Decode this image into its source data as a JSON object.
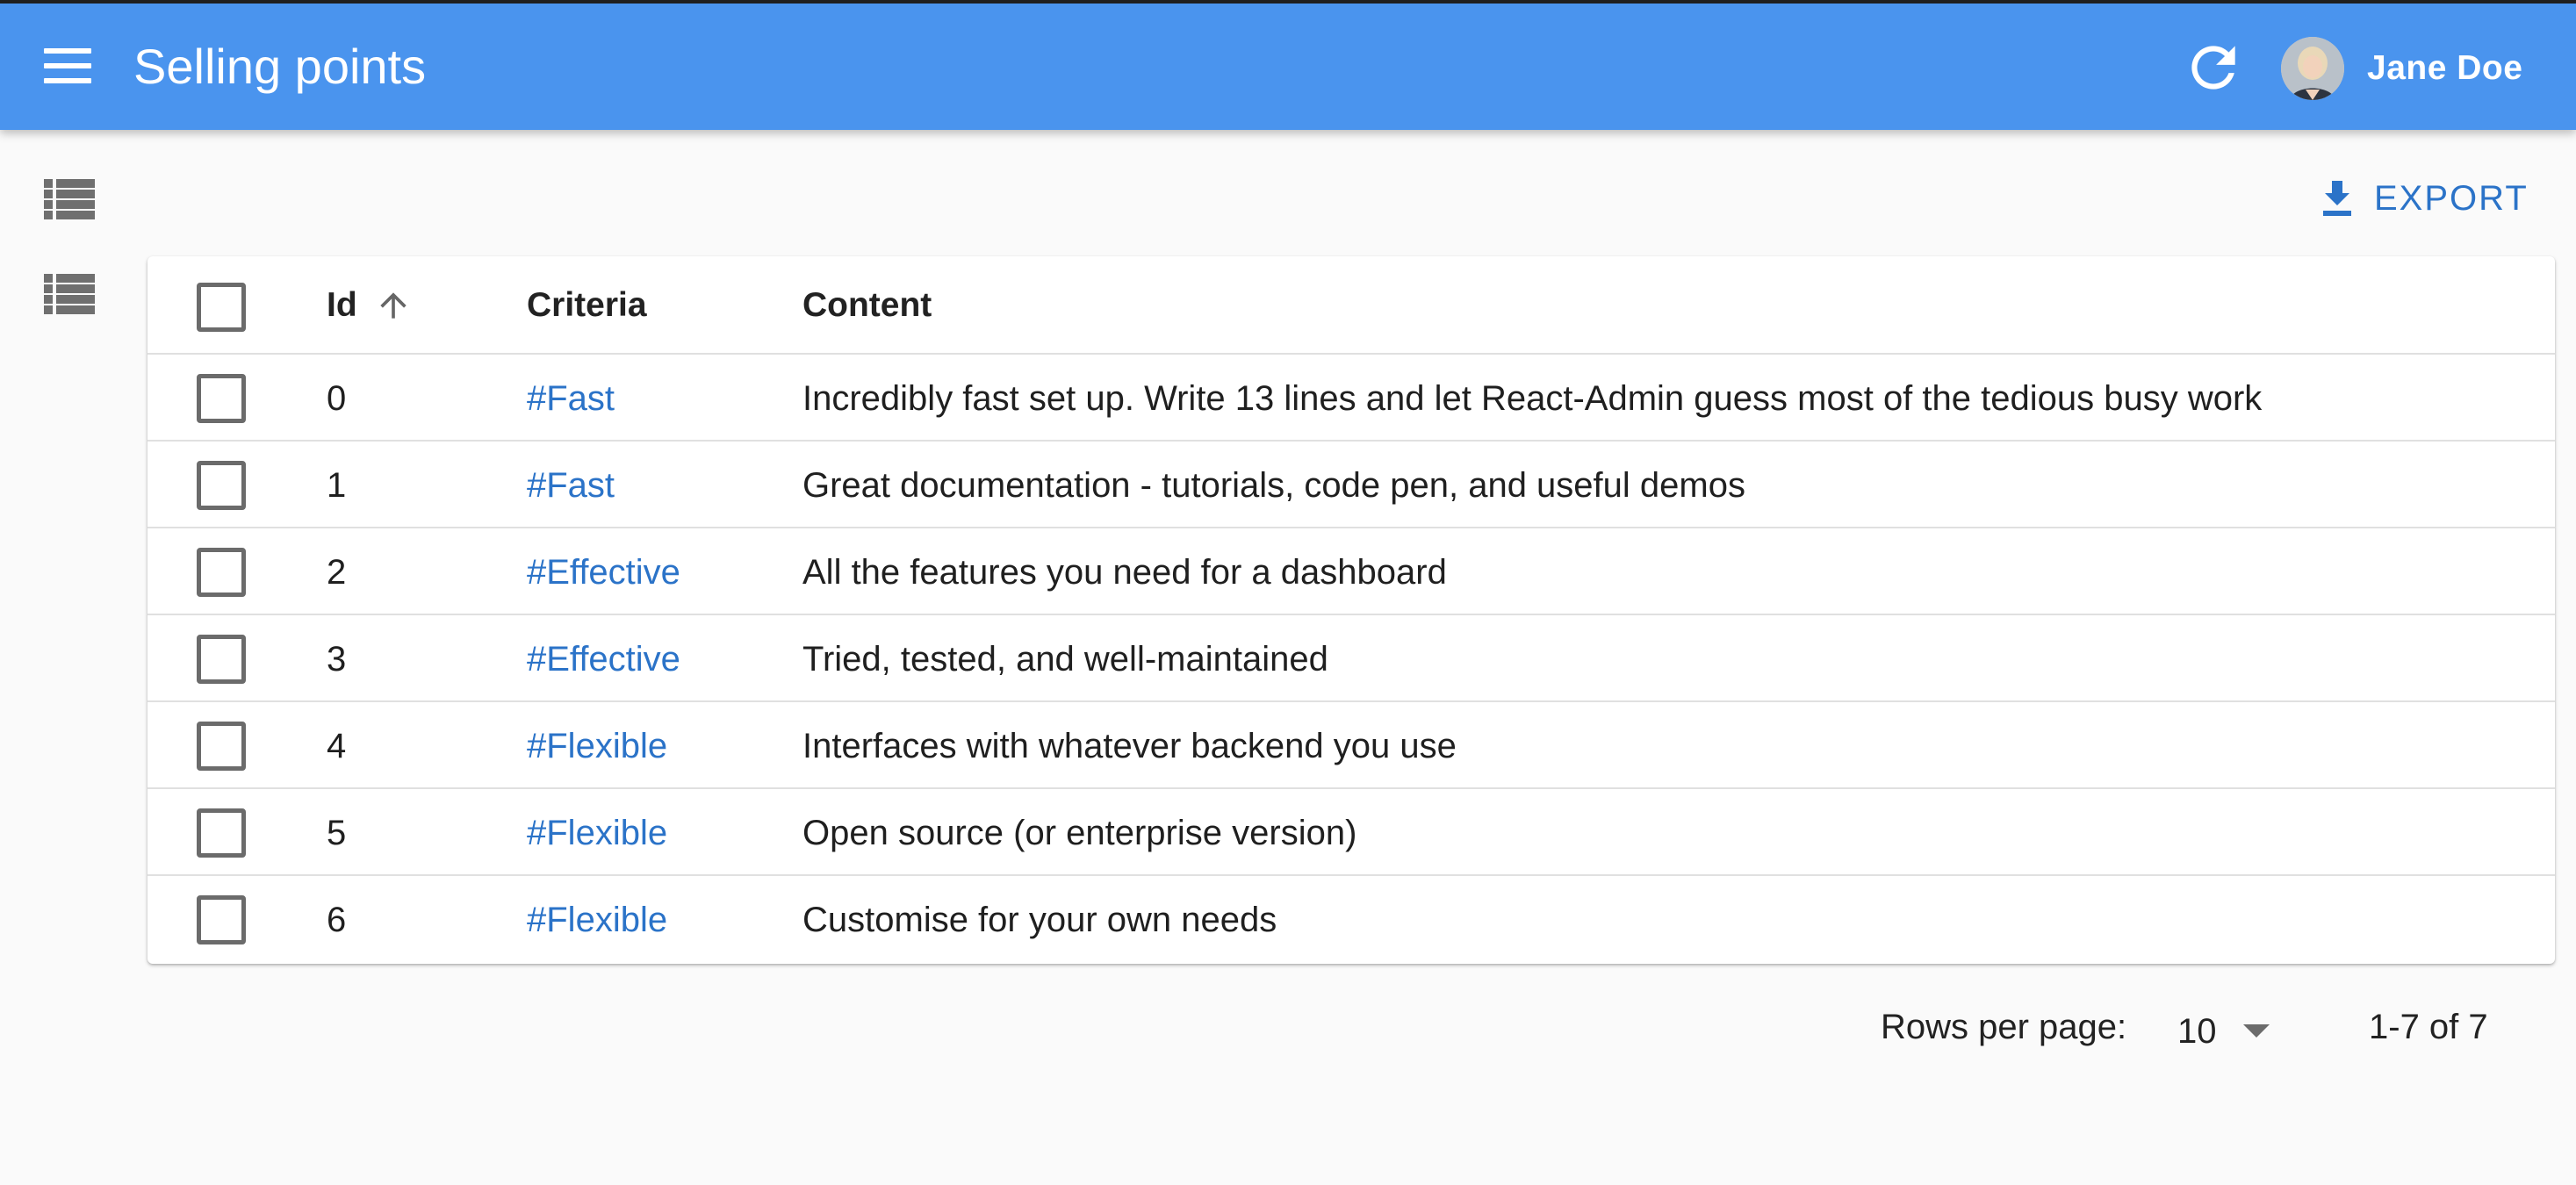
{
  "header": {
    "title": "Selling points",
    "user_name": "Jane Doe",
    "icons": [
      "menu-icon",
      "refresh-icon",
      "user-avatar"
    ]
  },
  "sidebar": {
    "items": [
      {
        "icon": "list-icon"
      },
      {
        "icon": "list-icon"
      }
    ]
  },
  "toolbar": {
    "export_label": "EXPORT",
    "export_icon": "download-icon"
  },
  "table": {
    "columns": {
      "id": "Id",
      "criteria": "Criteria",
      "content": "Content"
    },
    "sort": {
      "column": "Id",
      "direction": "ascending"
    },
    "rows": [
      {
        "id": "0",
        "criteria": "#Fast",
        "content": "Incredibly fast set up. Write 13 lines and let React-Admin guess most of the tedious busy work"
      },
      {
        "id": "1",
        "criteria": "#Fast",
        "content": "Great documentation - tutorials, code pen, and useful demos"
      },
      {
        "id": "2",
        "criteria": "#Effective",
        "content": "All the features you need for a dashboard"
      },
      {
        "id": "3",
        "criteria": "#Effective",
        "content": "Tried, tested, and well-maintained"
      },
      {
        "id": "4",
        "criteria": "#Flexible",
        "content": "Interfaces with whatever backend you use"
      },
      {
        "id": "5",
        "criteria": "#Flexible",
        "content": "Open source (or enterprise version)"
      },
      {
        "id": "6",
        "criteria": "#Flexible",
        "content": "Customise for your own needs"
      }
    ]
  },
  "pagination": {
    "rows_per_page_label": "Rows per page:",
    "rows_per_page_value": "10",
    "range_text": "1-7 of 7"
  },
  "colors": {
    "appbar": "#4a94ee",
    "accent": "#2b73c8",
    "background": "#fafafa"
  }
}
